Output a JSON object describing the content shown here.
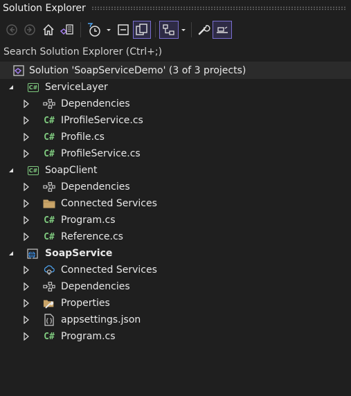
{
  "window": {
    "title": "Solution Explorer"
  },
  "toolbar": {
    "items": [
      "back-icon",
      "forward-icon",
      "home-icon",
      "switch-views-icon",
      "pending-changes-filter-icon",
      "dropdown-arrow-icon",
      "collapse-all-icon",
      "show-all-files-icon",
      "sync-with-active-document-icon",
      "dropdown-arrow-icon",
      "properties-icon",
      "preview-selected-items-icon"
    ]
  },
  "search": {
    "placeholder": "Search Solution Explorer (Ctrl+;)"
  },
  "tree": {
    "solution": {
      "label": "Solution 'SoapServiceDemo' (3 of 3 projects)"
    },
    "projects": [
      {
        "label": "ServiceLayer",
        "items": [
          {
            "label": "Dependencies",
            "icon": "dependencies-icon"
          },
          {
            "label": "IProfileService.cs",
            "icon": "csharp-file-icon"
          },
          {
            "label": "Profile.cs",
            "icon": "csharp-file-icon"
          },
          {
            "label": "ProfileService.cs",
            "icon": "csharp-file-icon"
          }
        ]
      },
      {
        "label": "SoapClient",
        "items": [
          {
            "label": "Dependencies",
            "icon": "dependencies-icon"
          },
          {
            "label": "Connected Services",
            "icon": "folder-icon"
          },
          {
            "label": "Program.cs",
            "icon": "csharp-file-icon"
          },
          {
            "label": "Reference.cs",
            "icon": "csharp-file-icon"
          }
        ]
      },
      {
        "label": "SoapService",
        "items": [
          {
            "label": "Connected Services",
            "icon": "connected-services-icon"
          },
          {
            "label": "Dependencies",
            "icon": "dependencies-icon"
          },
          {
            "label": "Properties",
            "icon": "properties-folder-icon"
          },
          {
            "label": "appsettings.json",
            "icon": "json-file-icon"
          },
          {
            "label": "Program.cs",
            "icon": "csharp-file-icon"
          }
        ]
      }
    ]
  },
  "colors": {
    "background": "#1f1f1f",
    "accent": "#7a6fd0",
    "csharp": "#7ec97e"
  }
}
